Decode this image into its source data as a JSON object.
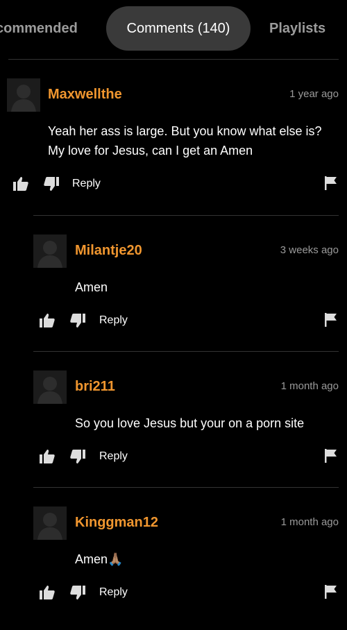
{
  "tabs": {
    "recommended": "commended",
    "comments": "Comments (140)",
    "playlists": "Playlists"
  },
  "comments": [
    {
      "username": "Maxwellthe",
      "time": "1 year ago",
      "text": "Yeah her ass is large. But you know what else is? My love for Jesus, can I get an Amen",
      "reply_label": "Reply"
    },
    {
      "username": "Milantje20",
      "time": "3 weeks ago",
      "text": "Amen",
      "reply_label": "Reply"
    },
    {
      "username": "bri211",
      "time": "1 month ago",
      "text": "So you love Jesus but your on a porn site",
      "reply_label": "Reply"
    },
    {
      "username": "Kinggman12",
      "time": "1 month ago",
      "text": "Amen🙏🏽",
      "reply_label": "Reply"
    }
  ],
  "colors": {
    "background": "#000000",
    "username": "#f0962f",
    "muted": "#9b9b9b",
    "active_tab": "#3a3a3a"
  },
  "icons": {
    "like": "thumbs-up-icon",
    "dislike": "thumbs-down-icon",
    "flag": "flag-icon",
    "avatar": "default-avatar-icon"
  }
}
